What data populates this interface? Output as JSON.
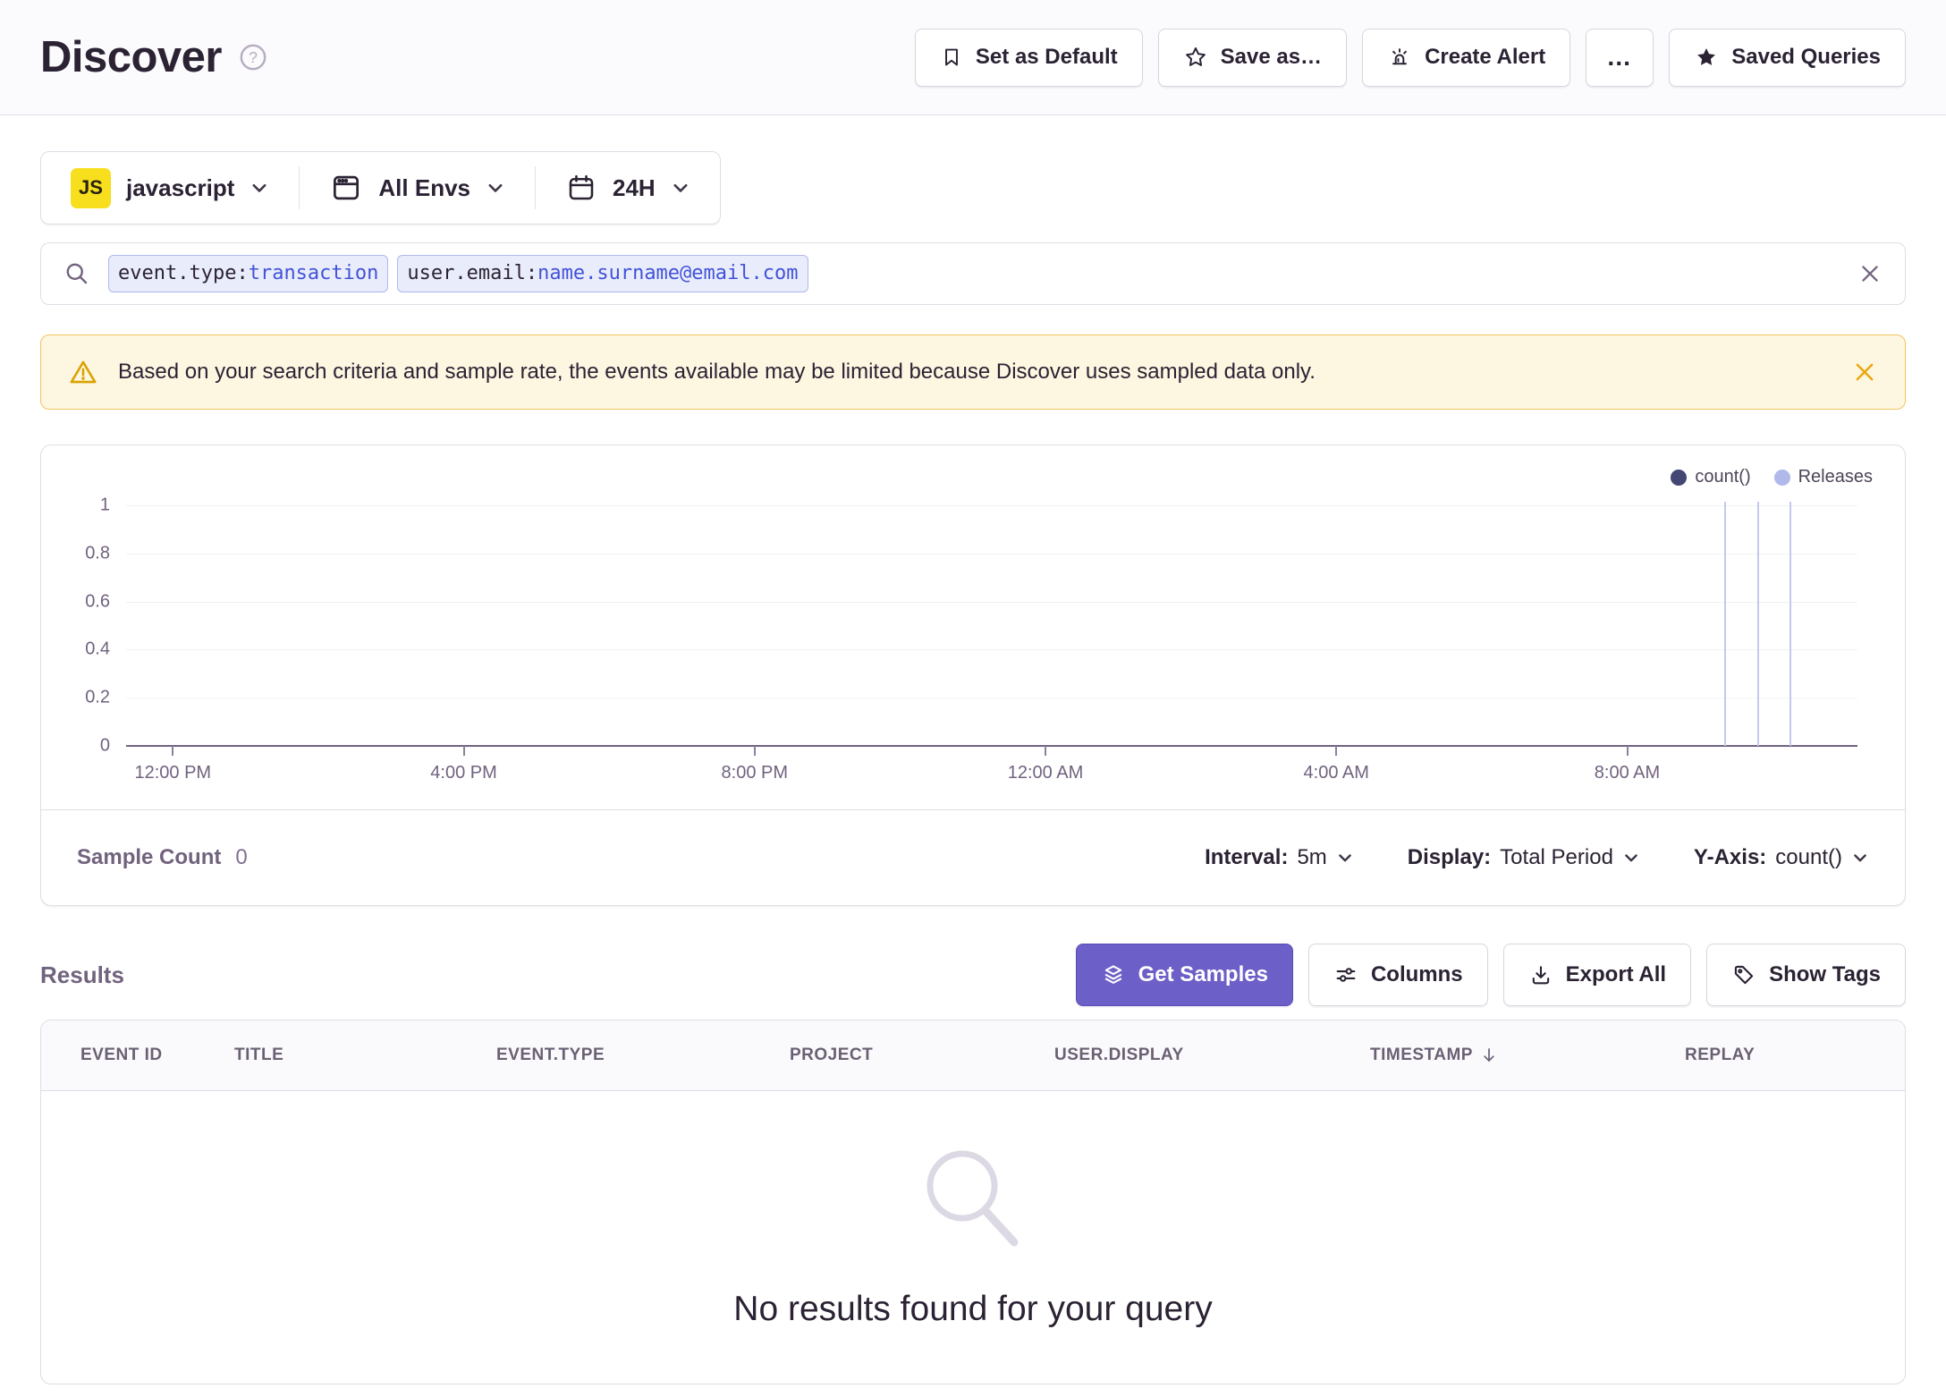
{
  "header": {
    "title": "Discover",
    "actions": [
      {
        "label": "Set as Default",
        "icon": "bookmark-icon"
      },
      {
        "label": "Save as…",
        "icon": "star-outline-icon"
      },
      {
        "label": "Create Alert",
        "icon": "siren-icon"
      },
      {
        "label": "…",
        "icon": "ellipsis-icon"
      },
      {
        "label": "Saved Queries",
        "icon": "star-filled-icon"
      }
    ]
  },
  "filters": {
    "project": {
      "badge": "JS",
      "label": "javascript"
    },
    "environment": {
      "label": "All Envs"
    },
    "date_range": {
      "label": "24H"
    }
  },
  "search": {
    "tokens": [
      {
        "key": "event.type:",
        "value": "transaction"
      },
      {
        "key": "user.email:",
        "value": "name.surname@email.com"
      }
    ]
  },
  "banner": {
    "text": "Based on your search criteria and sample rate, the events available may be limited because Discover uses sampled data only."
  },
  "chart_data": {
    "type": "line",
    "title": "",
    "xlabel": "",
    "ylabel": "",
    "ylim": [
      0,
      1
    ],
    "grid": true,
    "legend_position": "top-right",
    "legend": [
      {
        "name": "count()",
        "color": "#444674"
      },
      {
        "name": "Releases",
        "color": "#B0B9EA"
      }
    ],
    "x_ticks": [
      "12:00 PM",
      "4:00 PM",
      "8:00 PM",
      "12:00 AM",
      "4:00 AM",
      "8:00 AM"
    ],
    "y_ticks": [
      "1",
      "0.8",
      "0.6",
      "0.4",
      "0.2",
      "0"
    ],
    "series": [
      {
        "name": "count()",
        "values": [],
        "note": "no data plotted – sample count is 0"
      }
    ],
    "release_markers": [
      {
        "approx_time": "9:20 AM",
        "position_pct": 92.3
      },
      {
        "approx_time": "9:50 AM",
        "position_pct": 94.2
      },
      {
        "approx_time": "10:15 AM",
        "position_pct": 96.1
      }
    ]
  },
  "chart_footer": {
    "sample_count_label": "Sample Count",
    "sample_count_value": "0",
    "interval_label": "Interval:",
    "interval_value": "5m",
    "display_label": "Display:",
    "display_value": "Total Period",
    "yaxis_label": "Y-Axis:",
    "yaxis_value": "count()"
  },
  "results": {
    "heading": "Results",
    "buttons": [
      {
        "label": "Get Samples",
        "icon": "stack-icon",
        "primary": true
      },
      {
        "label": "Columns",
        "icon": "sliders-icon",
        "primary": false
      },
      {
        "label": "Export All",
        "icon": "download-icon",
        "primary": false
      },
      {
        "label": "Show Tags",
        "icon": "tag-icon",
        "primary": false
      }
    ],
    "table": {
      "columns": [
        "EVENT ID",
        "TITLE",
        "EVENT.TYPE",
        "PROJECT",
        "USER.DISPLAY",
        "TIMESTAMP",
        "REPLAY"
      ],
      "sorted_column": "TIMESTAMP",
      "sort_direction": "desc",
      "rows": []
    },
    "empty_message": "No results found for your query"
  },
  "colors": {
    "accent_purple": "#6C5FC7",
    "warning_bg": "#FDF7E2",
    "warning_border": "#EFC65B",
    "warning_icon": "#D9A302",
    "token_value_blue": "#4352D9",
    "chip_bg": "#E9EDFB",
    "chip_border": "#AFB8EE",
    "legend_count": "#444674",
    "legend_releases": "#B0B9EA",
    "js_badge_yellow": "#F7DF1E"
  }
}
